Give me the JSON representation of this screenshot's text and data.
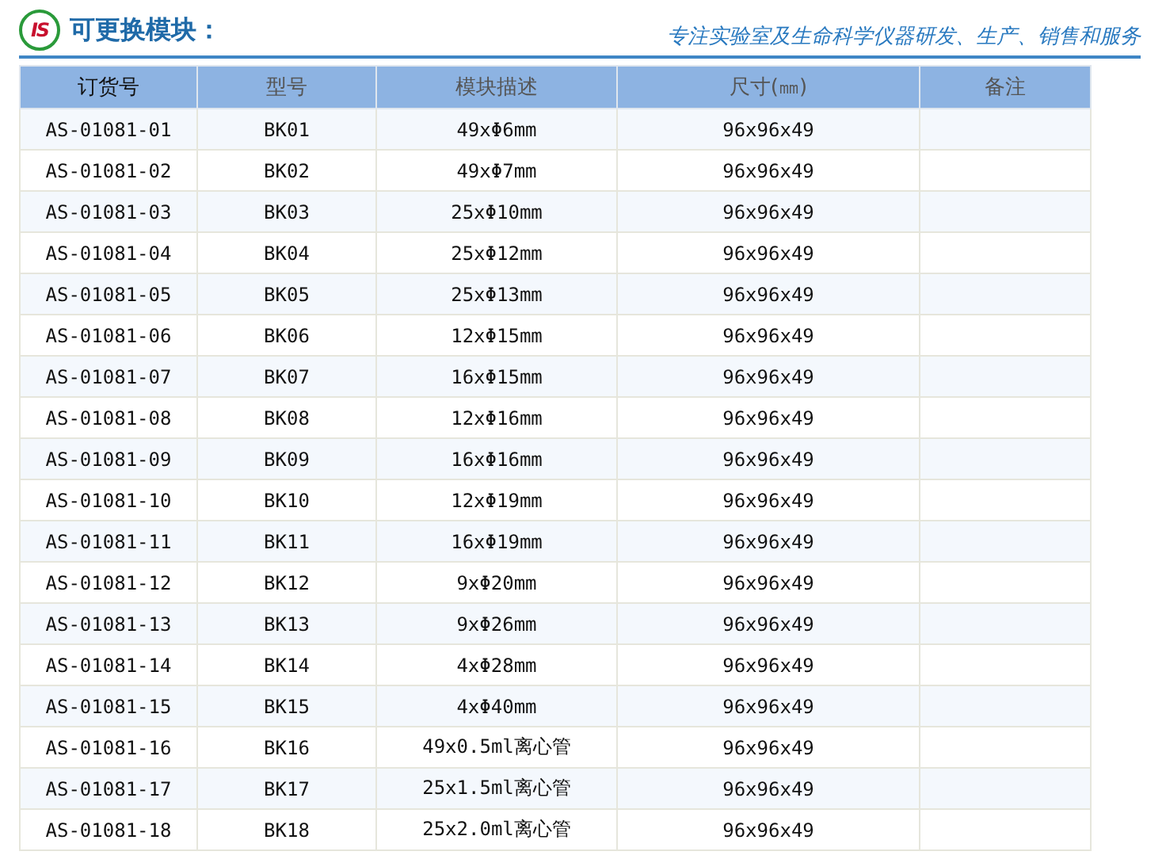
{
  "header": {
    "logo": "IS",
    "title": "可更换模块：",
    "slogan": "专注实验室及生命科学仪器研发、生产、销售和服务"
  },
  "table": {
    "columns": [
      {
        "label": "订货号",
        "selected": true
      },
      {
        "label": "型号",
        "selected": false
      },
      {
        "label": "模块描述",
        "selected": false
      },
      {
        "label": "尺寸(㎜)",
        "selected": false
      },
      {
        "label": "备注",
        "selected": false
      }
    ],
    "rows": [
      [
        "AS-01081-01",
        "BK01",
        "49xΦ6mm",
        "96x96x49",
        ""
      ],
      [
        "AS-01081-02",
        "BK02",
        "49xΦ7mm",
        "96x96x49",
        ""
      ],
      [
        "AS-01081-03",
        "BK03",
        "25xΦ10mm",
        "96x96x49",
        ""
      ],
      [
        "AS-01081-04",
        "BK04",
        "25xΦ12mm",
        "96x96x49",
        ""
      ],
      [
        "AS-01081-05",
        "BK05",
        "25xΦ13mm",
        "96x96x49",
        ""
      ],
      [
        "AS-01081-06",
        "BK06",
        "12xΦ15mm",
        "96x96x49",
        ""
      ],
      [
        "AS-01081-07",
        "BK07",
        "16xΦ15mm",
        "96x96x49",
        ""
      ],
      [
        "AS-01081-08",
        "BK08",
        "12xΦ16mm",
        "96x96x49",
        ""
      ],
      [
        "AS-01081-09",
        "BK09",
        "16xΦ16mm",
        "96x96x49",
        ""
      ],
      [
        "AS-01081-10",
        "BK10",
        "12xΦ19mm",
        "96x96x49",
        ""
      ],
      [
        "AS-01081-11",
        "BK11",
        "16xΦ19mm",
        "96x96x49",
        ""
      ],
      [
        "AS-01081-12",
        "BK12",
        "9xΦ20mm",
        "96x96x49",
        ""
      ],
      [
        "AS-01081-13",
        "BK13",
        "9xΦ26mm",
        "96x96x49",
        ""
      ],
      [
        "AS-01081-14",
        "BK14",
        "4xΦ28mm",
        "96x96x49",
        ""
      ],
      [
        "AS-01081-15",
        "BK15",
        "4xΦ40mm",
        "96x96x49",
        ""
      ],
      [
        "AS-01081-16",
        "BK16",
        "49x0.5ml离心管",
        "96x96x49",
        ""
      ],
      [
        "AS-01081-17",
        "BK17",
        "25x1.5ml离心管",
        "96x96x49",
        ""
      ],
      [
        "AS-01081-18",
        "BK18",
        "25x2.0ml离心管",
        "96x96x49",
        ""
      ]
    ]
  }
}
